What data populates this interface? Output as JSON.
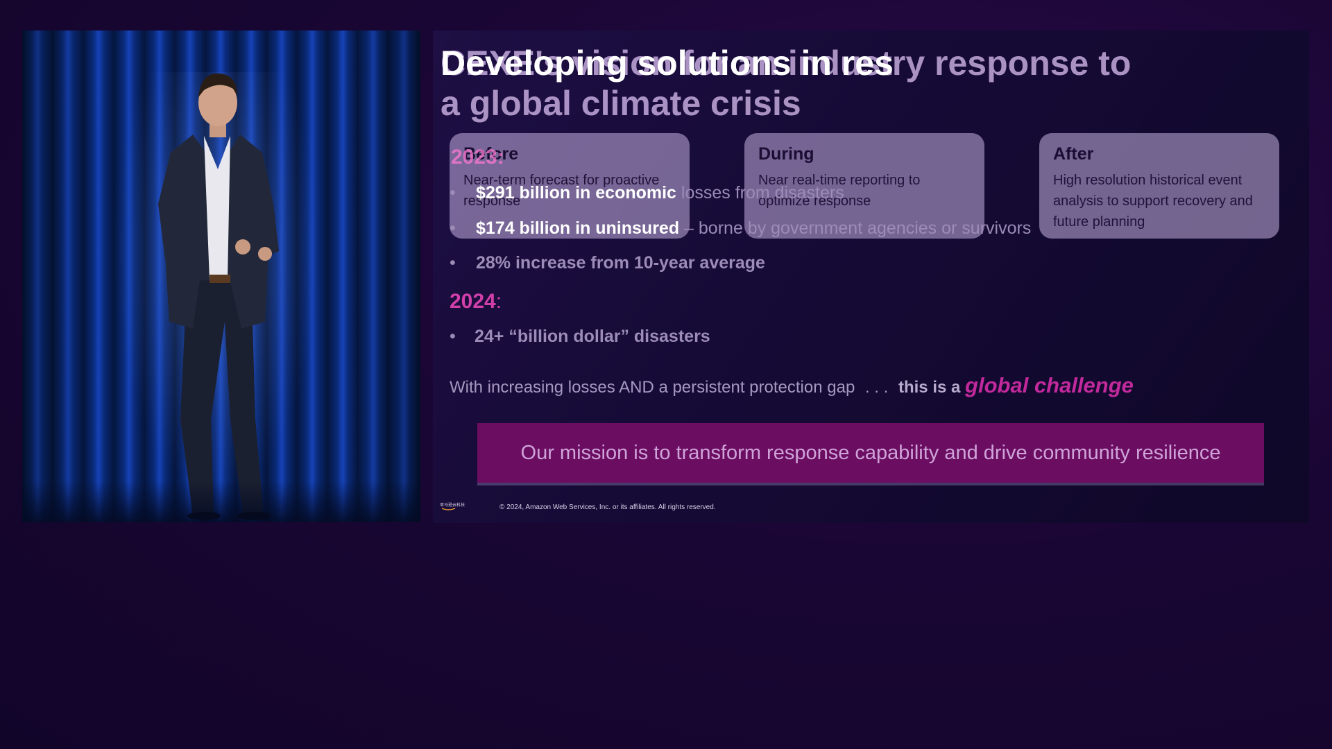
{
  "slide": {
    "title_back": "CEXE's vision for an industry response to a global climate crisis",
    "title_front": "Developing solutions in response to a global climate crisis",
    "title_front_overlay": "Developing solutions in res",
    "cards": [
      {
        "heading": "Before",
        "body": "Near-term forecast for proactive response"
      },
      {
        "heading": "During",
        "body": "Near real-time reporting to optimize response"
      },
      {
        "heading": "After",
        "body": "High resolution historical event analysis to support recovery and future planning"
      }
    ],
    "year_2023": "2023",
    "year_2023_colon": ":",
    "bullets_2023": [
      {
        "strong": "$291 billion in economic",
        "rest": " losses from disasters"
      },
      {
        "strong": "$174 billion in uninsured",
        "rest": " – borne by government agencies or survivors"
      },
      {
        "strong": "28% increase from 10-year average",
        "rest": ""
      }
    ],
    "bullet_glyph": "•",
    "year_2024": "2024",
    "year_2024_colon": ":",
    "bullets_2024": [
      {
        "strong": "24+ “billion dollar” disasters",
        "rest": ""
      }
    ],
    "challenge_lead": "With increasing losses AND a persistent protection gap",
    "challenge_ellipsis": ". . .",
    "challenge_strong": "this is a",
    "challenge_emph": "global challenge",
    "mission": "Our mission is to transform response capability and drive community resilience",
    "footer_logo_text": "亚马逊云科技",
    "footer_copyright": "© 2024, Amazon Web Services, Inc. or its affiliates. All rights reserved."
  },
  "colors": {
    "accent_magenta": "#c1299c",
    "mission_bg": "#6b0e62",
    "card_bg": "#c4b0e0",
    "page_bg": "#1a0634",
    "curtain_blue": "#1643b8"
  }
}
